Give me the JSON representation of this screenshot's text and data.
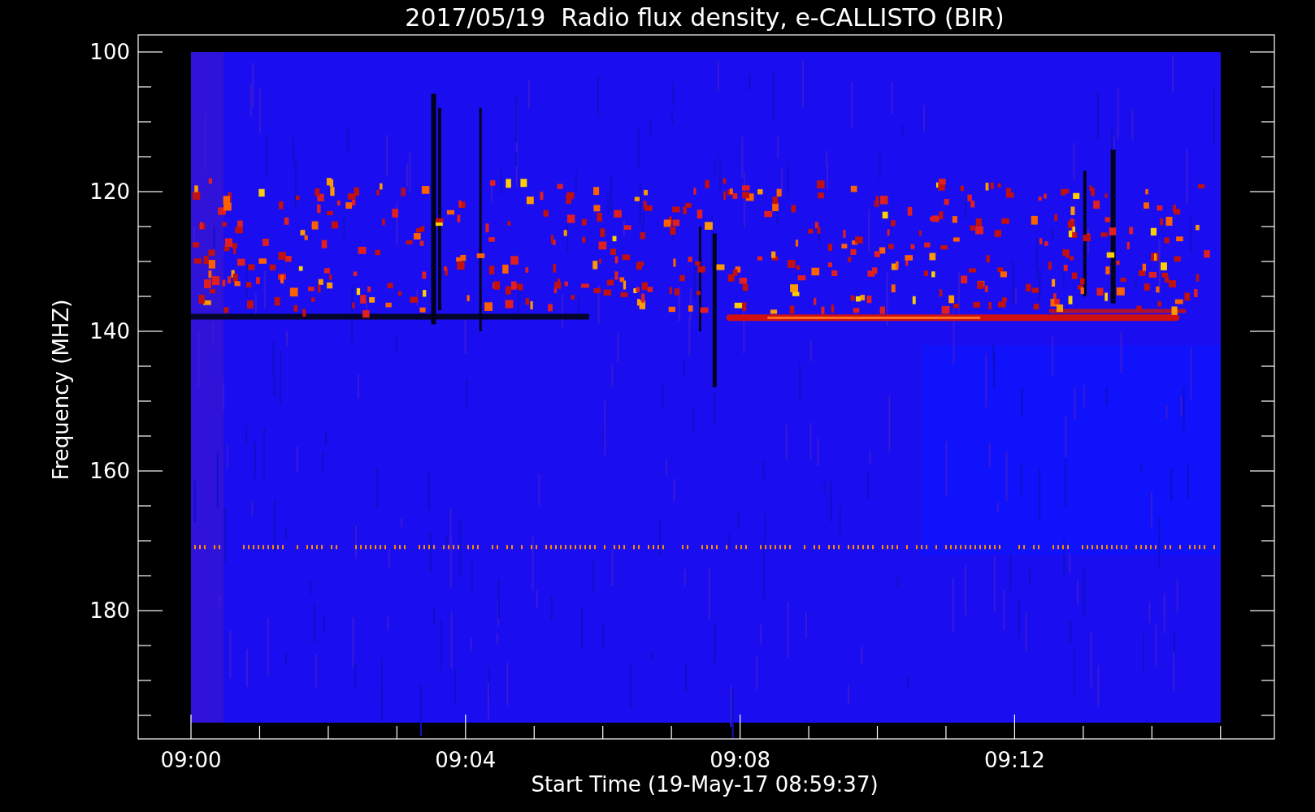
{
  "chart": {
    "title": "2017/05/19  Radio flux density, e-CALLISTO (BIR)",
    "ylabel": "Frequency (MHZ)",
    "xlabel": "Start Time (19-May-17 08:59:37)",
    "yticks": [
      "100",
      "120",
      "140",
      "160",
      "180"
    ],
    "xticks": [
      "09:00",
      "09:04",
      "09:08",
      "09:12"
    ]
  }
}
